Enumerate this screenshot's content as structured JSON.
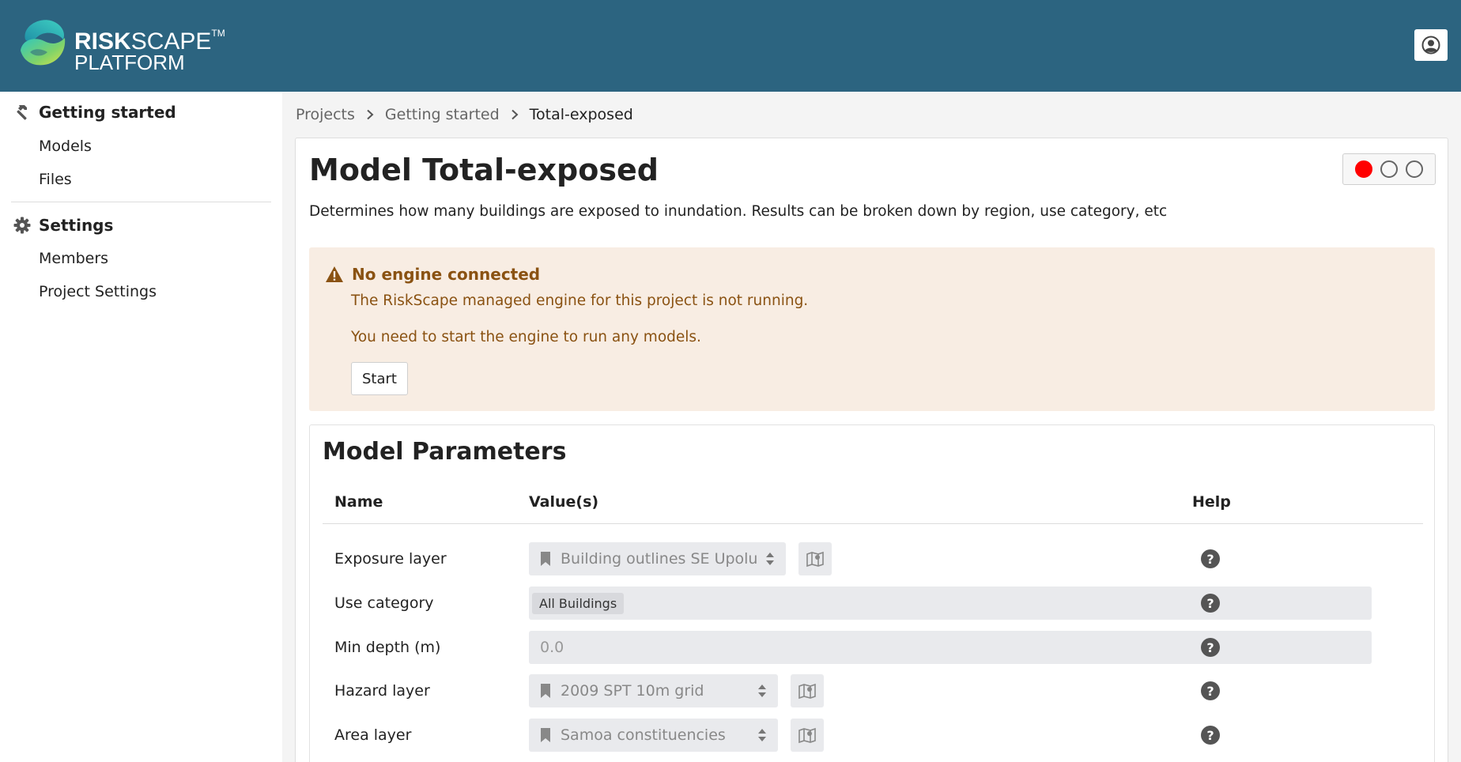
{
  "brand": {
    "line1_bold": "RISK",
    "line1_light": "SCAPE",
    "tm": "TM",
    "line2": "PLATFORM"
  },
  "sidebar": {
    "sections": [
      {
        "label": "Getting started",
        "icon": "hammer-icon",
        "items": [
          "Models",
          "Files"
        ]
      },
      {
        "label": "Settings",
        "icon": "gear-icon",
        "items": [
          "Members",
          "Project Settings"
        ]
      }
    ]
  },
  "breadcrumb": [
    "Projects",
    "Getting started",
    "Total-exposed"
  ],
  "model": {
    "title": "Model Total-exposed",
    "description": "Determines how many buildings are exposed to inundation. Results can be broken down by region, use category, etc"
  },
  "warning": {
    "title": "No engine connected",
    "line1": "The RiskScape managed engine for this project is not running.",
    "line2": "You need to start the engine to run any models.",
    "start_label": "Start"
  },
  "params": {
    "title": "Model Parameters",
    "headers": {
      "name": "Name",
      "values": "Value(s)",
      "help": "Help"
    },
    "rows": [
      {
        "label": "Exposure layer",
        "value": "Building outlines SE Upolu"
      },
      {
        "label": "Use category",
        "value": "All Buildings"
      },
      {
        "label": "Min depth (m)",
        "value": "0.0"
      },
      {
        "label": "Hazard layer",
        "value": "2009 SPT 10m grid"
      },
      {
        "label": "Area layer",
        "value": "Samoa constituencies"
      }
    ],
    "help_glyph": "?"
  },
  "colors": {
    "header": "#2c6480",
    "warning_bg": "#f8ede3",
    "warning_text": "#8a5212",
    "status_red": "#ff0000"
  }
}
